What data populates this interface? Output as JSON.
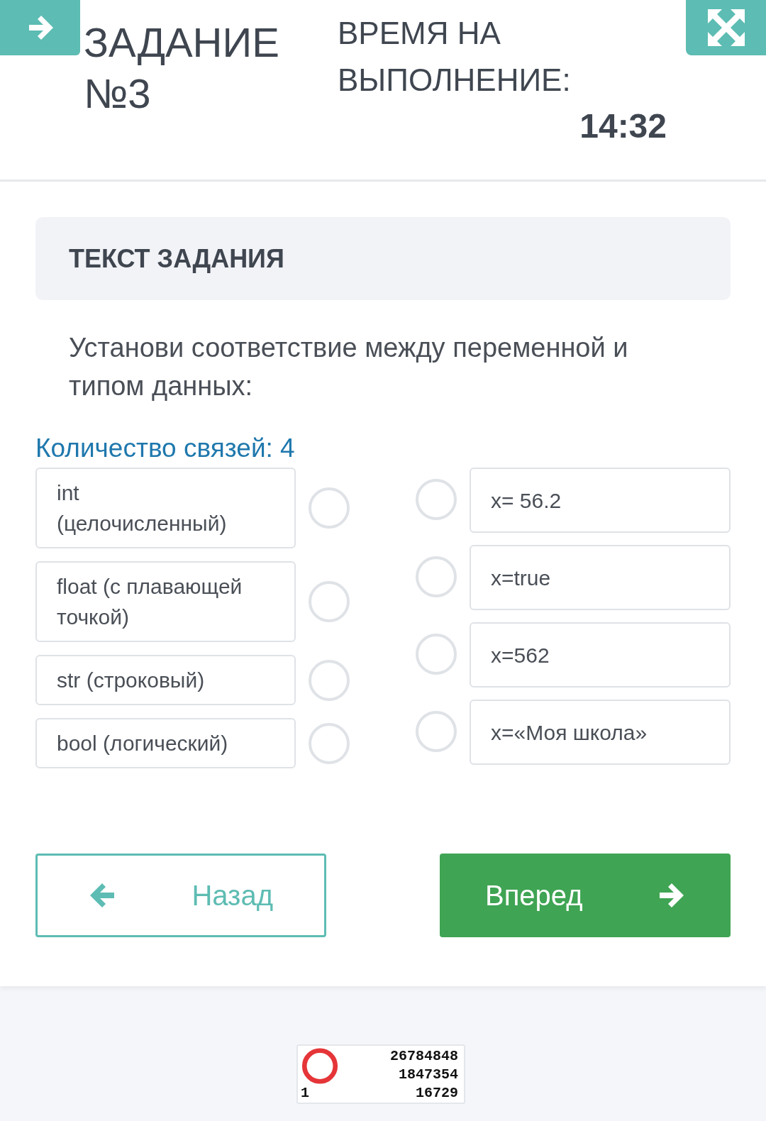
{
  "header": {
    "title": "ЗАДАНИЕ №3",
    "timer_label": "ВРЕМЯ НА ВЫПОЛНЕНИЕ:",
    "timer_value": "14:32"
  },
  "task": {
    "heading": "ТЕКСТ ЗАДАНИЯ",
    "question": "Установи соответствие между переменной и типом данных:",
    "links_count": "Количество связей: 4"
  },
  "left_items": [
    {
      "text": "int (целочисленный)",
      "selected": false
    },
    {
      "text": "float (с плавающей точкой)",
      "selected": false
    },
    {
      "text": "str (строковый)",
      "selected": false
    },
    {
      "text": "bool (логический)",
      "selected": false
    }
  ],
  "right_items": [
    {
      "text": "x= 56.2",
      "selected": false
    },
    {
      "text": "x=true",
      "selected": false
    },
    {
      "text": "x=562",
      "selected": false
    },
    {
      "text": "x=«Моя школа»",
      "selected": false
    }
  ],
  "buttons": [
    {
      "kind": "back",
      "label": "Назад"
    },
    {
      "kind": "next",
      "label": "Вперед"
    }
  ],
  "counter": {
    "lines": [
      "26784848",
      "1847354",
      "16729"
    ],
    "corner": "1"
  }
}
